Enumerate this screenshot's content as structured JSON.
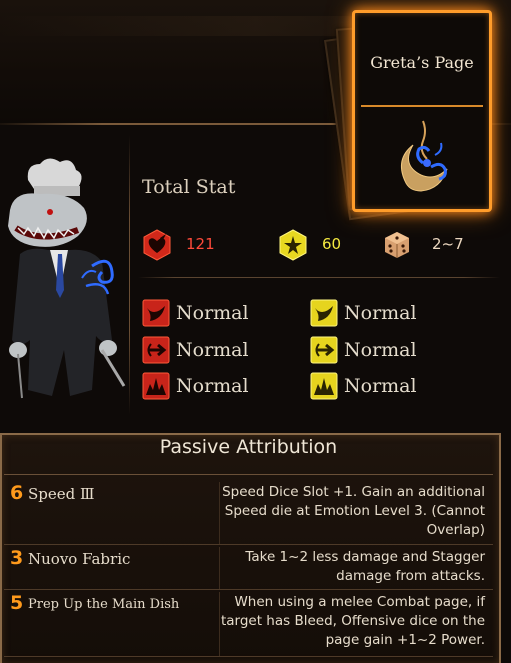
{
  "page_card": {
    "title": "Greta’s Page"
  },
  "stats": {
    "heading": "Total Stat",
    "hp": "121",
    "stagger": "60",
    "speed": "2~7"
  },
  "resistances": {
    "hp": [
      "Normal",
      "Normal",
      "Normal"
    ],
    "stagger": [
      "Normal",
      "Normal",
      "Normal"
    ]
  },
  "passive": {
    "title": "Passive Attribution",
    "items": [
      {
        "cost": "6",
        "name": "Speed Ⅲ",
        "desc": "Speed Dice Slot +1. Gain an additional Speed die at Emotion Level 3. (Cannot Overlap)"
      },
      {
        "cost": "3",
        "name": "Nuovo Fabric",
        "desc": "Take 1~2 less damage and Stagger damage from attacks."
      },
      {
        "cost": "5",
        "name": "Prep Up the Main Dish",
        "desc": "When using a melee Combat page, if target has Bleed, Offensive dice on the page gain +1~2 Power."
      }
    ]
  },
  "colors": {
    "hp": "#e0301c",
    "stagger": "#f0e020",
    "accent": "#ff9c2a"
  }
}
